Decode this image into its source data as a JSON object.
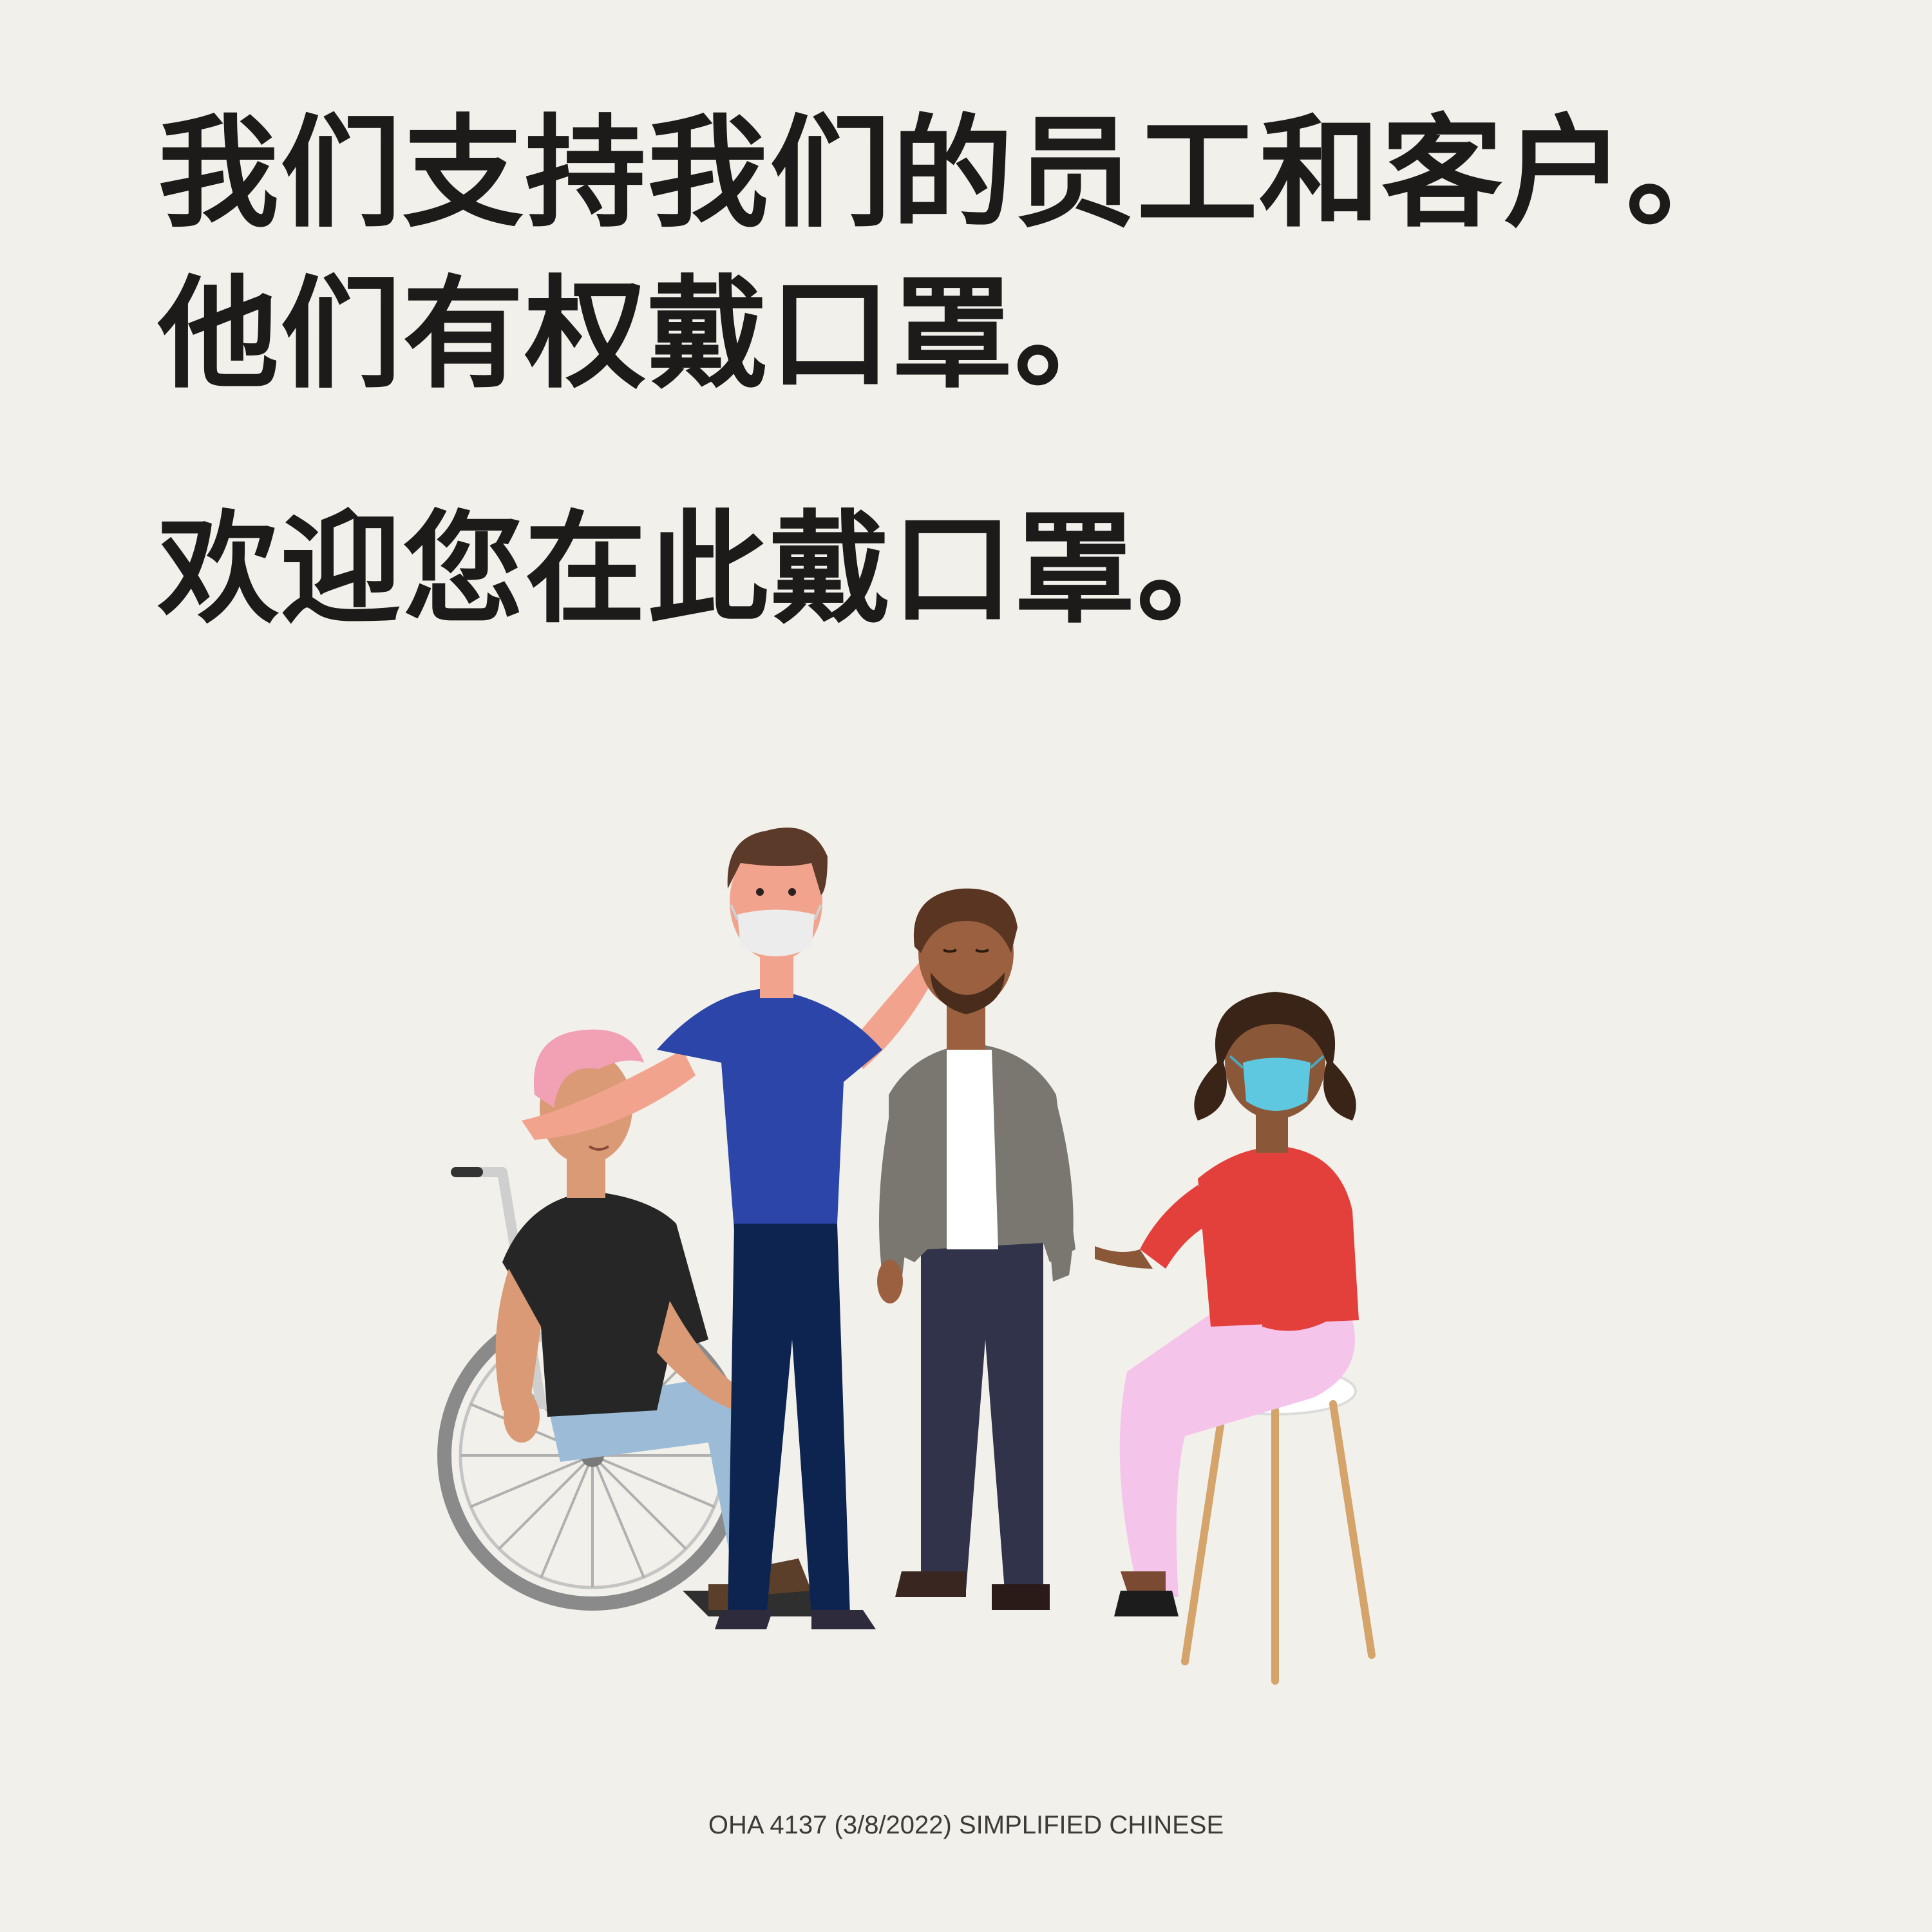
{
  "headline": {
    "line1": "我们支持我们的员工和客户。",
    "line2": "他们有权戴口罩。",
    "line3": "欢迎您在此戴口罩。"
  },
  "footer": {
    "code": "OHA 4137 (3/8/2022) SIMPLIFIED CHINESE"
  },
  "colors": {
    "background": "#f2f0eb",
    "text": "#1c1b19",
    "mask_white": "#ececec",
    "mask_blue": "#5dc8e0",
    "shirt_blue": "#2b45a8",
    "sweater_red": "#e3403c",
    "pants_pink": "#f5c4ea",
    "jacket_gray": "#7a7670",
    "tshirt_black": "#262626",
    "jeans_light": "#9bbbd6",
    "hair_pink": "#f2a0b4"
  }
}
